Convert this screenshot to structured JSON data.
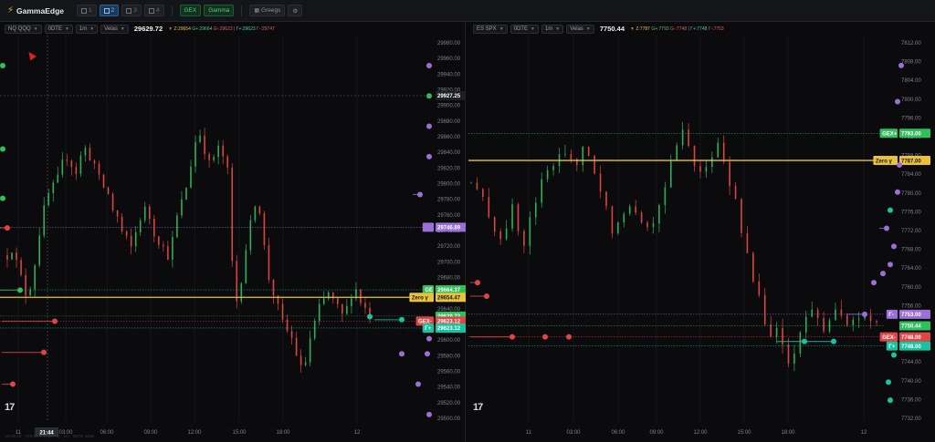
{
  "topbar": {
    "brand": "GammaEdge",
    "layout_buttons": [
      {
        "label": "1",
        "active": false
      },
      {
        "label": "2",
        "active": true
      },
      {
        "label": "3",
        "active": false
      },
      {
        "label": "4",
        "active": false
      }
    ],
    "gex_label": "GEX",
    "gamma_label": "Gamma",
    "greeks_label": "Greegs",
    "settings_label": "⚙"
  },
  "left": {
    "symbol": "NQ QQQ",
    "expiry": "0DTE",
    "timeframe": "1m",
    "style": "Velas",
    "price": "29629.72",
    "legend": {
      "z": "Z:29654",
      "g": "G+:29664",
      "gm": "G-:29623",
      "t": "Γ+:29623",
      "tm": "Γ-:29747"
    },
    "crosshair_price": "29927.25",
    "crosshair_time": "21:44",
    "y_ticks": [
      "29980.00",
      "29960.00",
      "29940.00",
      "29920.00",
      "29900.00",
      "29880.00",
      "29860.00",
      "29840.00",
      "29820.00",
      "29800.00",
      "29780.00",
      "29760.00",
      "29740.00",
      "29720.00",
      "29700.00",
      "29680.00",
      "29660.00",
      "29640.00",
      "29620.00",
      "29600.00",
      "29580.00",
      "29560.00",
      "29540.00",
      "29520.00",
      "29500.00"
    ],
    "x_ticks": [
      "11",
      "03:00",
      "06:00",
      "09:00",
      "12:00",
      "15:00",
      "18:00",
      "12"
    ],
    "tags": [
      {
        "label": "Γ-",
        "price": "29746.89",
        "color": "#9b6fd6",
        "value": 29746.89
      },
      {
        "label": "GE",
        "price": "29664.37",
        "color": "#2fbf5b",
        "value": 29664.37
      },
      {
        "label": "Zero γ",
        "price": "29654.47",
        "color": "#e8c23a",
        "value": 29654.47
      },
      {
        "label": "",
        "price": "29629.72",
        "color": "#2fbf5b",
        "value": 29629.72
      },
      {
        "label": "GEX-",
        "price": "29623.12",
        "color": "#e04545",
        "value": 29623.12
      },
      {
        "label": "Γ+",
        "price": "29623.12",
        "color": "#17c3a0",
        "value": 29614.0
      }
    ]
  },
  "right": {
    "symbol": "ES SPX",
    "expiry": "0DTE",
    "timeframe": "1m",
    "style": "Velas",
    "price": "7750.44",
    "legend": {
      "z": "Z:7787",
      "g": "G+:7793",
      "gm": "G-:7748",
      "t": "Γ+:7748",
      "tm": "Γ-:7753"
    },
    "y_ticks": [
      "7812.00",
      "7808.00",
      "7804.00",
      "7800.00",
      "7796.00",
      "7792.00",
      "7788.00",
      "7784.00",
      "7780.00",
      "7776.00",
      "7772.00",
      "7768.00",
      "7764.00",
      "7760.00",
      "7756.00",
      "7752.00",
      "7748.00",
      "7744.00",
      "7740.00",
      "7736.00",
      "7732.00"
    ],
    "x_ticks": [
      "11",
      "03:00",
      "06:00",
      "09:00",
      "12:00",
      "15:00",
      "18:00",
      "12"
    ],
    "tags": [
      {
        "label": "GEX+",
        "price": "7793.00",
        "color": "#2fbf5b",
        "value": 7793.0
      },
      {
        "label": "Zero γ",
        "price": "7787.00",
        "color": "#e8c23a",
        "value": 7787.0
      },
      {
        "label": "Γ-",
        "price": "7753.00",
        "color": "#9b6fd6",
        "value": 7753.0
      },
      {
        "label": "",
        "price": "7750.44",
        "color": "#2fbf5b",
        "value": 7750.44
      },
      {
        "label": "GEX-",
        "price": "7748.00",
        "color": "#e04545",
        "value": 7748.0
      },
      {
        "label": "Γ+",
        "price": "7748.00",
        "color": "#17c3a0",
        "value": 7746.0
      }
    ]
  },
  "status_bar": "01:00:10 · (HS 05 079 (EX+0) · 1m · 0DTE velas"
}
